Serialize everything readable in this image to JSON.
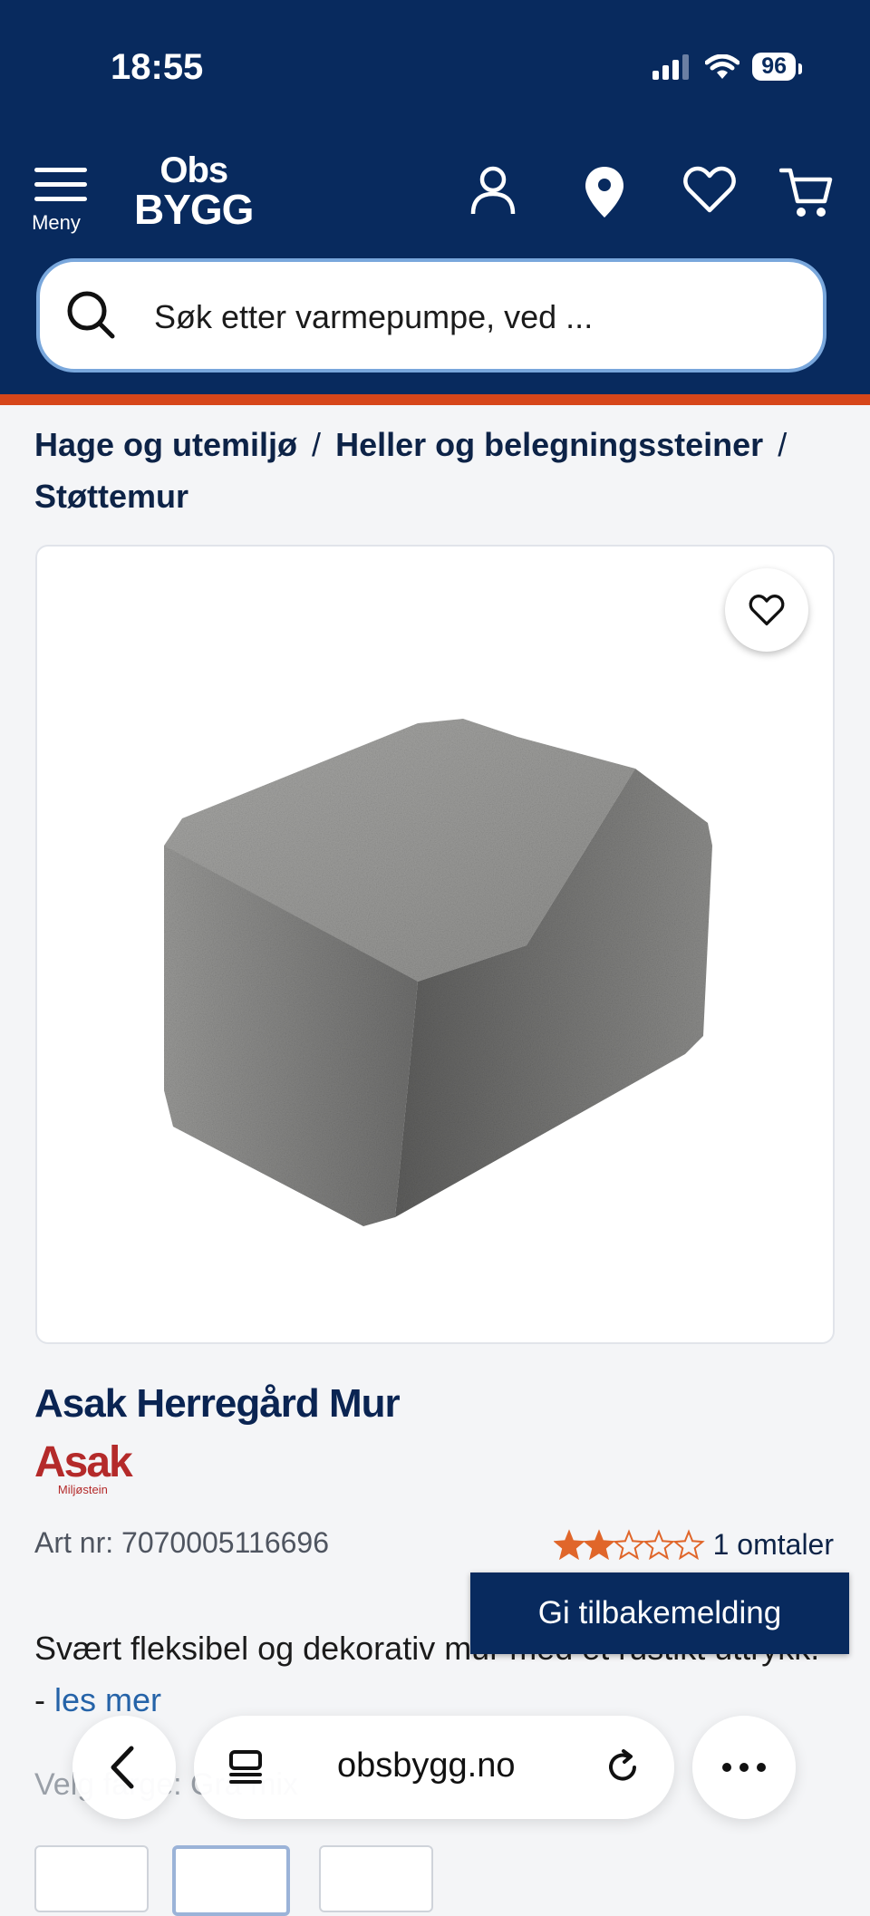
{
  "status": {
    "time": "18:55",
    "battery": "96"
  },
  "header": {
    "menu_label": "Meny",
    "logo_line1": "Obs",
    "logo_line2": "BYGG"
  },
  "search": {
    "placeholder": "Søk etter varmepumpe, ved ..."
  },
  "breadcrumb": {
    "items": [
      "Hage og utemiljø",
      "Heller og belegningssteiner",
      "Støttemur"
    ],
    "separator": "/"
  },
  "product": {
    "title": "Asak Herregård Mur",
    "brand_name": "Asak",
    "brand_sub": "Miljøstein",
    "art_nr": "Art nr: 7070005116696",
    "rating_stars": 2,
    "rating_max": 5,
    "review_count": "1 omtaler",
    "description": "Svært fleksibel og dekorativ mur med et rustikt uttrykk. -",
    "read_more": "les mer",
    "variant_label": "Velg farge: Grå mix"
  },
  "feedback_button": "Gi tilbakemelding",
  "browser": {
    "url": "obsbygg.no"
  },
  "colors": {
    "header": "#082a5e",
    "accent": "#d6461a",
    "star": "#e0662a"
  }
}
